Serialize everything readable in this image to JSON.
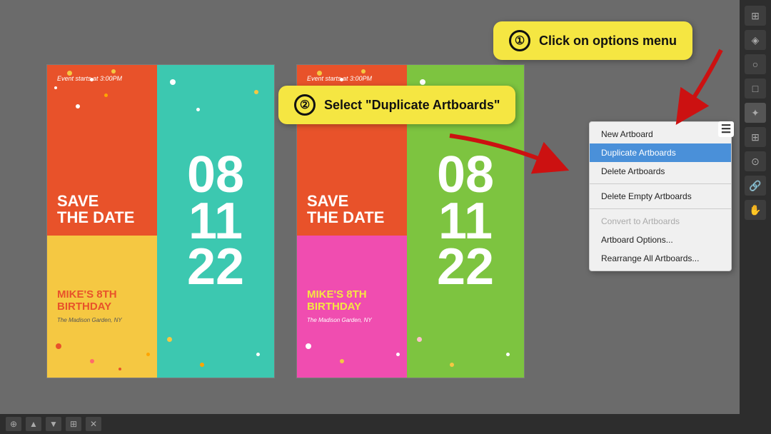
{
  "app": {
    "background": "#6b6b6b"
  },
  "tooltip1": {
    "number": "①",
    "text": "Click on options menu"
  },
  "tooltip2": {
    "number": "②",
    "text": "Select \"Duplicate Artboards\""
  },
  "artboard1": {
    "event_text": "Event starts at 3:00PM",
    "save_date": "SAVE\nTHE DATE",
    "birthday_name": "MIKE'S 8TH\nBIRTHDAY",
    "location": "The Madison Garden, NY",
    "numbers": [
      "08",
      "11",
      "22"
    ]
  },
  "artboard2": {
    "event_text": "Event starts at 3:00PM",
    "save_date": "SAVE\nTHE DATE",
    "birthday_name": "MIKE'S 8TH\nBIRTHDAY",
    "location": "The Madison Garden, NY",
    "numbers": [
      "08",
      "11",
      "22"
    ]
  },
  "context_menu": {
    "items": [
      {
        "label": "New Artboard",
        "disabled": false,
        "highlighted": false
      },
      {
        "label": "Duplicate Artboards",
        "disabled": false,
        "highlighted": true
      },
      {
        "label": "Delete Artboards",
        "disabled": false,
        "highlighted": false
      },
      {
        "label": "Delete Empty Artboards",
        "disabled": false,
        "highlighted": false
      },
      {
        "label": "Convert to Artboards",
        "disabled": true,
        "highlighted": false
      },
      {
        "label": "Artboard Options...",
        "disabled": false,
        "highlighted": false
      },
      {
        "label": "Rearrange All Artboards...",
        "disabled": false,
        "highlighted": false
      }
    ]
  },
  "sidebar": {
    "tools": [
      "⊞",
      "◈",
      "○",
      "□",
      "✦",
      "⊕",
      "⊙"
    ]
  },
  "bottom_toolbar": {
    "tools": [
      "⊕",
      "⊖",
      "⊻",
      "▲",
      "▼",
      "⊞",
      "✕"
    ]
  }
}
